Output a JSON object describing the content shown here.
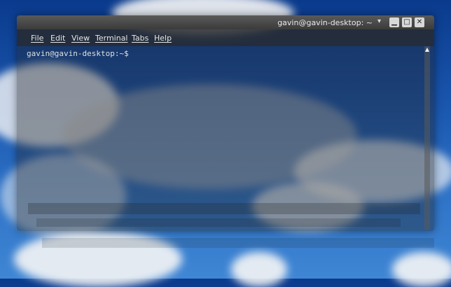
{
  "window": {
    "title": "gavin@gavin-desktop: ~"
  },
  "menubar": {
    "items": [
      "File",
      "Edit",
      "View",
      "Terminal",
      "Tabs",
      "Help"
    ]
  },
  "terminal": {
    "prompt": "gavin@gavin-desktop:~$"
  },
  "icons": {
    "minimize": "minimize-icon",
    "maximize": "maximize-icon",
    "close": "close-icon",
    "title_dropdown": "chevron-down-icon",
    "scroll_up": "arrow-up-icon"
  },
  "colors": {
    "sky": "#1b58b0",
    "titlebar": "#3b3b3b",
    "terminal_text": "#e0e0e0"
  }
}
